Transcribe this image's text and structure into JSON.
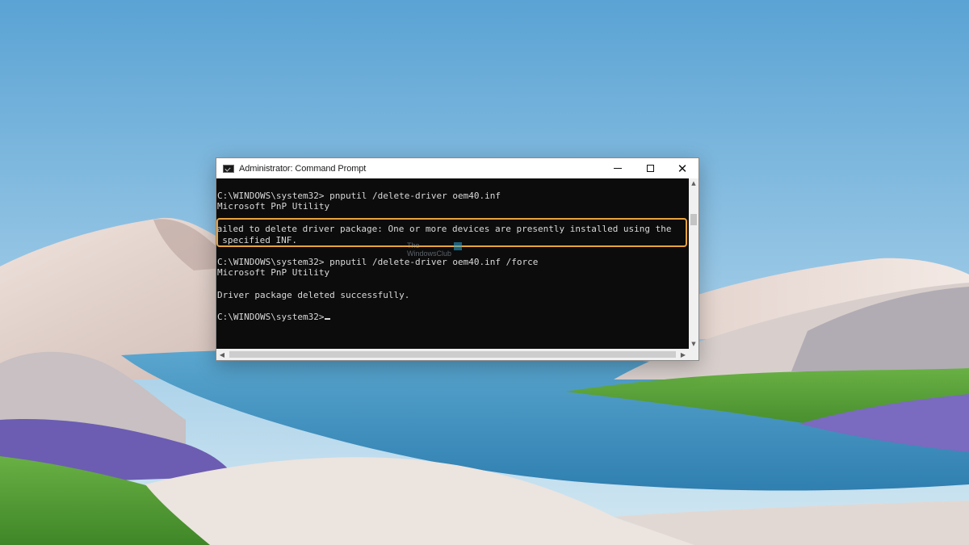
{
  "window": {
    "title": "Administrator: Command Prompt",
    "controls": {
      "minimize_icon": "minimize-icon",
      "maximize_icon": "maximize-icon",
      "close_glyph": "✕"
    }
  },
  "console": {
    "lines": [
      "C:\\WINDOWS\\system32> pnputil /delete-driver oem40.inf",
      "Microsoft PnP Utility",
      "",
      "Failed to delete driver package: One or more devices are presently installed using the",
      "  specified INF.",
      "",
      "C:\\WINDOWS\\system32> pnputil /delete-driver oem40.inf /force",
      "Microsoft PnP Utility",
      "",
      "Driver package deleted successfully.",
      "",
      "C:\\WINDOWS\\system32>"
    ],
    "highlight_color": "#e8a33c",
    "text_color": "#d9d9d9",
    "background_color": "#0c0c0c"
  },
  "watermark": {
    "text": "The\nWindowsClub"
  },
  "colors": {
    "sky_top": "#5fa6d6",
    "sky_bottom": "#b9dbee",
    "water": "#3f93c4",
    "grass": "#4f9a34",
    "lavender": "#6b5bb0"
  }
}
